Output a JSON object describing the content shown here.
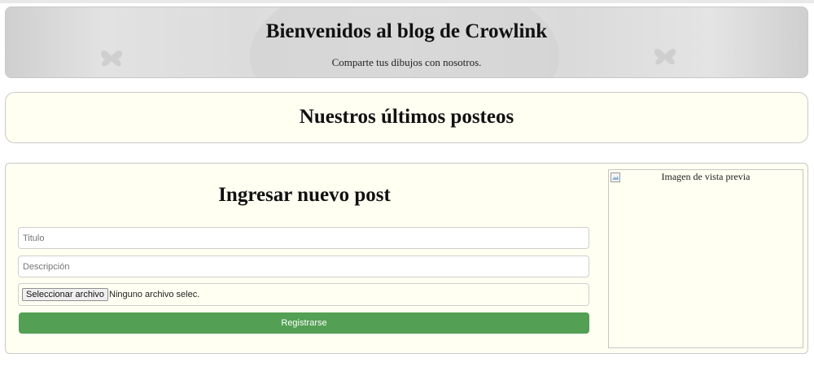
{
  "header": {
    "title": "Bienvenidos al blog de Crowlink",
    "subtitle": "Comparte tus dibujos con nosotros."
  },
  "posts_section": {
    "title": "Nuestros últimos posteos"
  },
  "new_post": {
    "title": "Ingresar nuevo post",
    "title_field": {
      "placeholder": "Titulo",
      "value": ""
    },
    "description_field": {
      "placeholder": "Descripción",
      "value": ""
    },
    "file_input": {
      "button_label": "Seleccionar archivo",
      "status": "Ninguno archivo selec."
    },
    "submit_label": "Registrarse",
    "submit_color": "#53a054"
  },
  "preview": {
    "alt_text": "Imagen de vista previa",
    "icon": "broken-image-icon"
  },
  "colors": {
    "panel_background": "#fffff2",
    "border": "#c9c9c9"
  }
}
